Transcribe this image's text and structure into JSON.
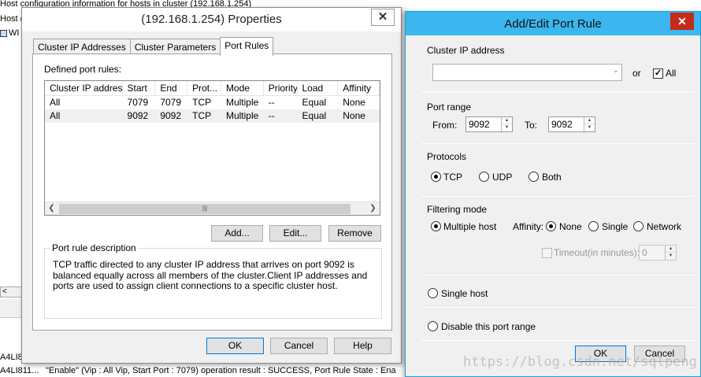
{
  "background": {
    "header": "Host configuration information for hosts in cluster (192.168.1.254)",
    "host_col": "Host (",
    "host_item": "WI",
    "scroll_arrow": "<",
    "log_row1_id": "A4LI8",
    "log_row2_id": "A4LI811...",
    "log_row2_msg": "\"Enable\" (Vip : All Vip, Start Port : 7079) operation result : SUCCESS, Port Rule State : Ena"
  },
  "props": {
    "title": "(192.168.1.254) Properties",
    "close": "✕",
    "tabs": [
      "Cluster IP Addresses",
      "Cluster Parameters",
      "Port Rules"
    ],
    "defined_label": "Defined port rules:",
    "columns": [
      "Cluster IP address",
      "Start",
      "End",
      "Prot...",
      "Mode",
      "Priority",
      "Load",
      "Affinity"
    ],
    "rows": [
      [
        "All",
        "7079",
        "7079",
        "TCP",
        "Multiple",
        "--",
        "Equal",
        "None"
      ],
      [
        "All",
        "9092",
        "9092",
        "TCP",
        "Multiple",
        "--",
        "Equal",
        "None"
      ]
    ],
    "add": "Add...",
    "edit": "Edit...",
    "remove": "Remove",
    "desc_label": "Port rule description",
    "desc_text": "TCP traffic directed to any cluster IP address that arrives on port 9092 is balanced equally across all members of the cluster.Client IP addresses and ports are used to assign client connections to a specific cluster host.",
    "ok": "OK",
    "cancel": "Cancel",
    "help": "Help"
  },
  "addedit": {
    "title": "Add/Edit Port Rule",
    "close": "✕",
    "cluster_ip_label": "Cluster IP address",
    "cluster_ip_value": "",
    "or": "or",
    "all_label": "All",
    "all_checked": true,
    "port_range_label": "Port range",
    "from_label": "From:",
    "from_value": "9092",
    "to_label": "To:",
    "to_value": "9092",
    "protocols_label": "Protocols",
    "protocols": [
      "TCP",
      "UDP",
      "Both"
    ],
    "protocol_selected": "TCP",
    "filtering_label": "Filtering mode",
    "multiple_host": "Multiple host",
    "affinity_label": "Affinity:",
    "affinity_options": [
      "None",
      "Single",
      "Network"
    ],
    "affinity_selected": "None",
    "timeout_label": "Timeout(in minutes):",
    "timeout_value": "0",
    "single_host": "Single host",
    "disable_range": "Disable this port range",
    "ok": "OK",
    "cancel": "Cancel"
  },
  "watermark": "https://blog.csdn.net/sqlpeng"
}
